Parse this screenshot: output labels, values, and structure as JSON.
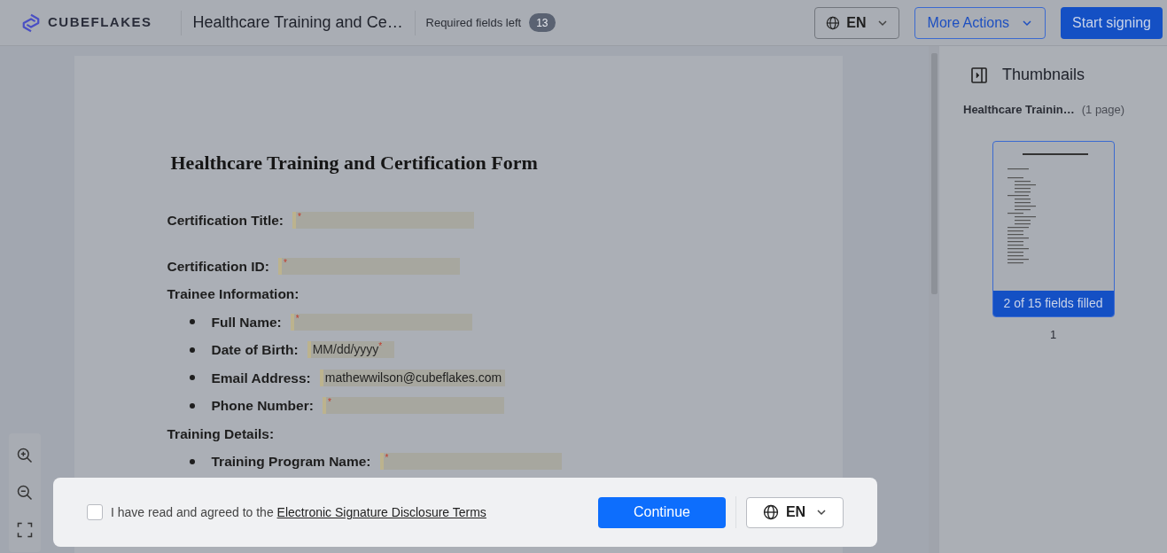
{
  "header": {
    "brand": "CUBEFLAKES",
    "document_title": "Healthcare Training and Ce…",
    "required_label": "Required fields left",
    "required_count": "13",
    "language": "EN",
    "more_actions": "More Actions",
    "start_signing": "Start signing"
  },
  "document": {
    "title": "Healthcare Training and Certification Form",
    "required_mark": "*",
    "items": [
      {
        "kind": "field",
        "label": "Certification Title:",
        "required": true
      },
      {
        "kind": "field",
        "label": "Certification ID:",
        "required": true
      },
      {
        "kind": "section",
        "label": "Trainee Information:",
        "children": [
          {
            "kind": "field",
            "label": "Full Name:",
            "required": true
          },
          {
            "kind": "field",
            "label": "Date of Birth:",
            "placeholder": "MM/dd/yyyy",
            "required": true
          },
          {
            "kind": "field",
            "label": "Email Address:",
            "value": "mathewwilson@cubeflakes.com",
            "required": false
          },
          {
            "kind": "field",
            "label": "Phone Number:",
            "required": true
          }
        ]
      },
      {
        "kind": "section",
        "label": "Training Details:",
        "children": [
          {
            "kind": "field",
            "label": "Training Program Name:",
            "required": true
          }
        ]
      }
    ]
  },
  "sidebar": {
    "title": "Thumbnails",
    "document_name": "Healthcare Trainin…",
    "page_count": "(1 page)",
    "thumbnails": [
      {
        "status": "2 of 15 fields filled",
        "page": "1",
        "selected": true
      }
    ]
  },
  "consent": {
    "checked": false,
    "text": "I have read and agreed to the ",
    "link": "Electronic Signature Disclosure Terms",
    "continue": "Continue",
    "language": "EN"
  }
}
